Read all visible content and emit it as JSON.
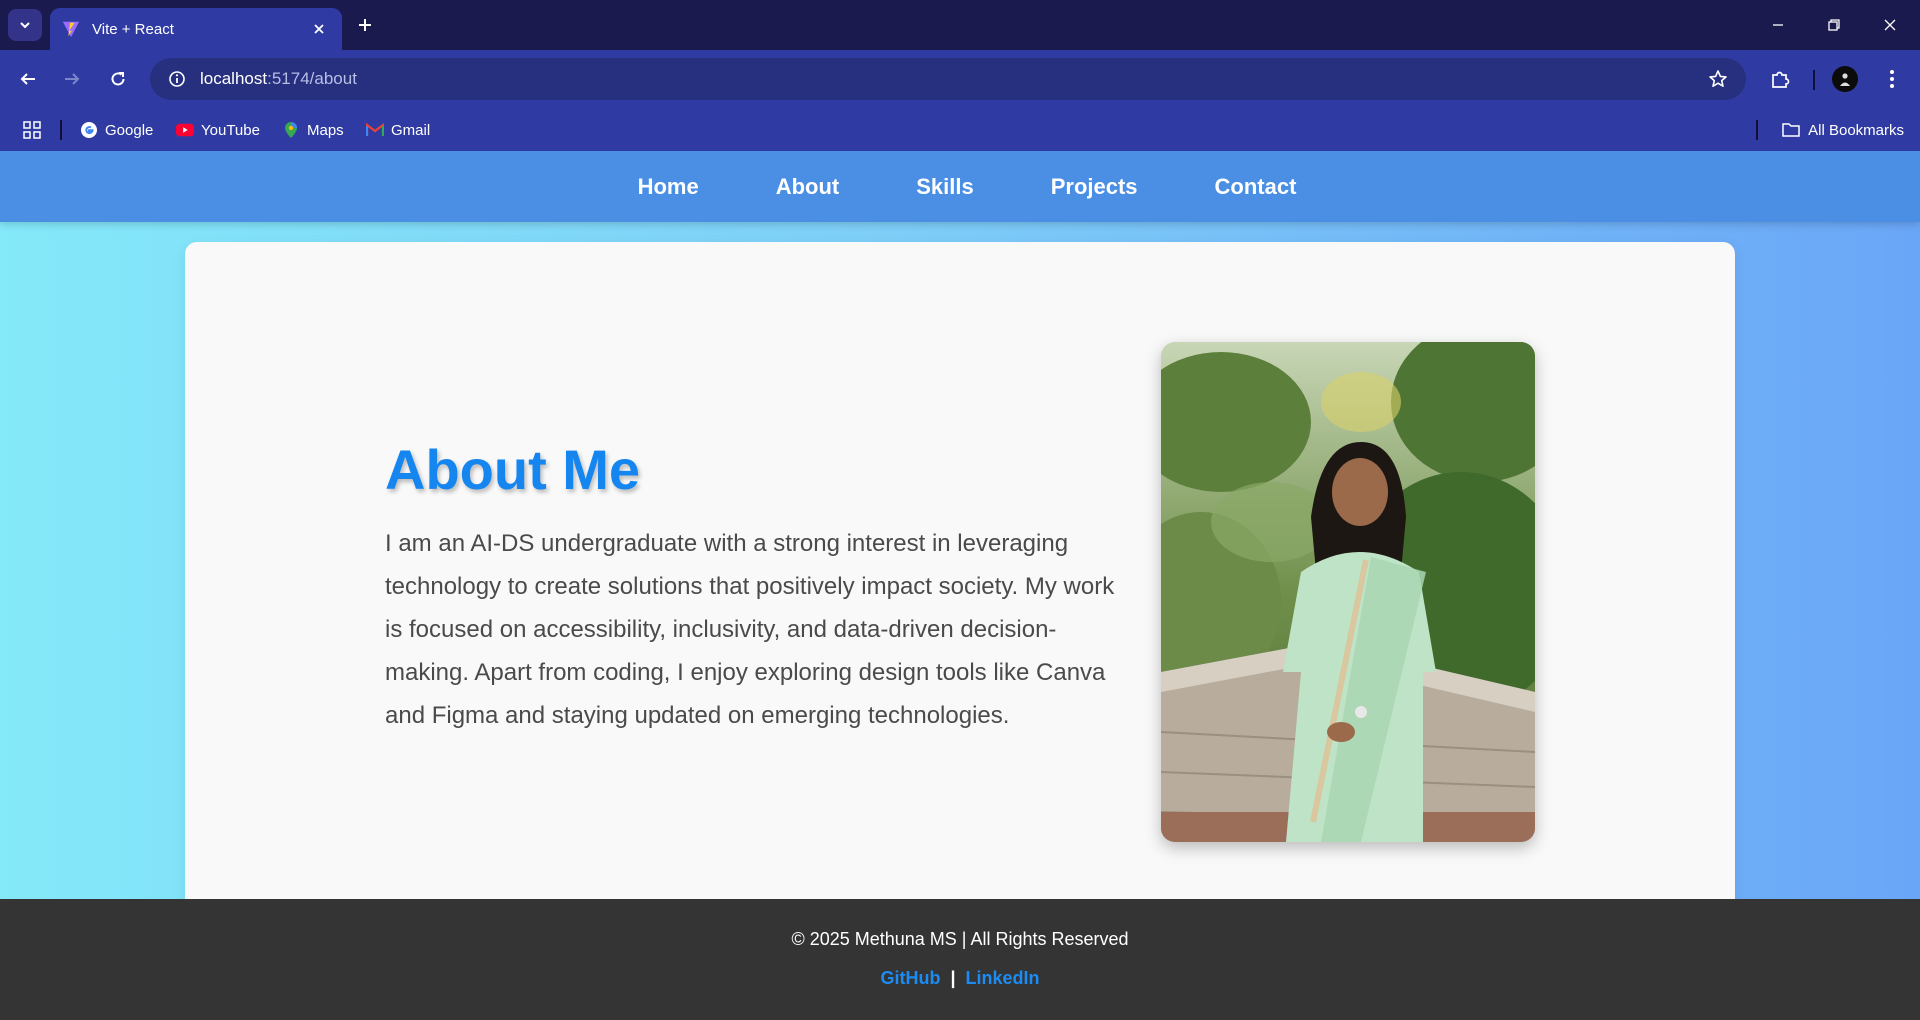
{
  "browser": {
    "tab_title": "Vite + React",
    "url_host": "localhost",
    "url_path": ":5174/about",
    "bookmarks": [
      {
        "label": "Google",
        "icon": "google-icon"
      },
      {
        "label": "YouTube",
        "icon": "youtube-icon"
      },
      {
        "label": "Maps",
        "icon": "maps-icon"
      },
      {
        "label": "Gmail",
        "icon": "gmail-icon"
      }
    ],
    "all_bookmarks_label": "All Bookmarks",
    "colors": {
      "frame": "#1b1a4f",
      "toolbar": "#2f3ba2",
      "omnibox": "#26307f"
    }
  },
  "nav": {
    "items": [
      "Home",
      "About",
      "Skills",
      "Projects",
      "Contact"
    ]
  },
  "about": {
    "title": "About Me",
    "body": "I am an AI-DS undergraduate with a strong interest in leveraging technology to create solutions that positively impact society. My work is focused on accessibility, inclusivity, and data-driven decision-making. Apart from coding, I enjoy exploring design tools like Canva and Figma and staying updated on emerging technologies."
  },
  "footer": {
    "copyright": "© 2025 Methuna MS | All Rights Reserved",
    "links": [
      "GitHub",
      "LinkedIn"
    ],
    "separator": "|"
  },
  "colors": {
    "accent": "#1585ef",
    "navbar": "#4a8fe4",
    "footer_bg": "#343434",
    "link": "#1a8cf3"
  }
}
